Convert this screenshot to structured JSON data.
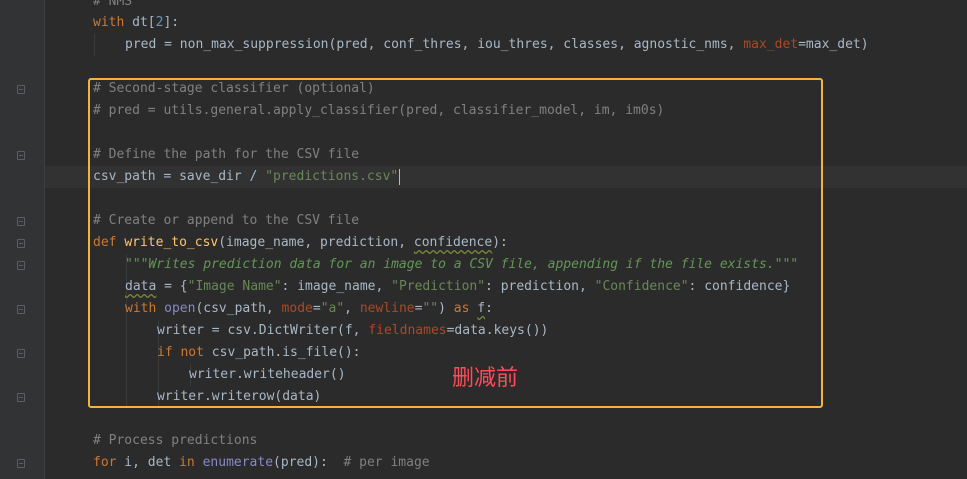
{
  "code": {
    "top_comment": "# NMS",
    "with_kw": "with",
    "dt_name": "dt",
    "dt_index": "2",
    "pred_line_a": "pred = non_max_suppression(pred, conf_thres, iou_thres, classes, agnostic_nms, ",
    "max_det_param": "max_det",
    "pred_line_b": "=max_det)",
    "comment_second_stage": "# Second-stage classifier (optional)",
    "comment_apply_classifier": "# pred = utils.general.apply_classifier(pred, classifier_model, im, im0s)",
    "comment_define_path": "# Define the path for the CSV file",
    "csv_path_assign": "csv_path = save_dir / ",
    "csv_path_string": "\"predictions.csv\"",
    "comment_create_append": "# Create or append to the CSV file",
    "def_kw": "def",
    "func_name": "write_to_csv",
    "func_params_a": "(image_name, prediction, ",
    "func_params_conf": "confidence",
    "func_params_b": "):",
    "docstring": "\"\"\"Writes prediction data for an image to a CSV file, appending if the file exists.\"\"\"",
    "data_var": "data",
    "data_eq": " = {",
    "key_image_name": "\"Image Name\"",
    "val_image_name": ": image_name, ",
    "key_prediction": "\"Prediction\"",
    "val_prediction": ": prediction, ",
    "key_confidence": "\"Confidence\"",
    "val_confidence": ": confidence}",
    "with_kw2": "with",
    "open_fn": "open",
    "open_args_a": "(csv_path, ",
    "mode_param": "mode",
    "mode_eq": "=",
    "mode_val": "\"a\"",
    "comma": ", ",
    "newline_param": "newline",
    "newline_eq": "=",
    "newline_val": "\"\"",
    "open_close": ") ",
    "as_kw": "as",
    "f_var": "f",
    "colon": ":",
    "writer_assign": "writer = csv.DictWriter(f, ",
    "fieldnames_param": "fieldnames",
    "writer_rest": "=data.keys())",
    "if_kw": "if",
    "not_kw": "not",
    "if_rest": " csv_path.is_file():",
    "writeheader": "writer.writeheader()",
    "writerow": "writer.writerow(data)",
    "comment_process": "# Process predictions",
    "for_kw": "for",
    "for_a": " i, det ",
    "in_kw": "in",
    "enumerate_fn": "enumerate",
    "for_b": "(pred):  ",
    "per_image_comment": "# per image"
  },
  "annotation_text": "删减前",
  "colors": {
    "background": "#2b2b2b",
    "highlight_border": "#f2b43a",
    "annotation": "#ff4b5c"
  }
}
